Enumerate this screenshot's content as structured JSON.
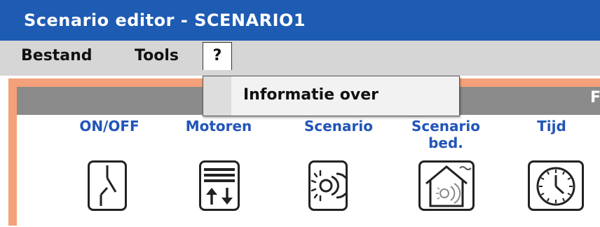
{
  "window": {
    "title": "Scenario editor - SCENARIO1"
  },
  "menubar": {
    "items": [
      {
        "label": "Bestand"
      },
      {
        "label": "Tools"
      },
      {
        "label": "?"
      }
    ]
  },
  "dropdown": {
    "items": [
      {
        "label": "Informatie over"
      }
    ]
  },
  "panel": {
    "header_partial": "Fa"
  },
  "toolbar": {
    "items": [
      {
        "label": "ON/OFF",
        "icon": "switch-icon"
      },
      {
        "label": "Motoren",
        "icon": "motor-icon"
      },
      {
        "label": "Scenario",
        "icon": "scenario-icon"
      },
      {
        "label": "Scenario\nbed.",
        "icon": "house-scenario-icon"
      },
      {
        "label": "Tijd",
        "icon": "clock-icon"
      }
    ]
  },
  "colors": {
    "titlebar": "#1e5bb2",
    "menubar": "#d6d6d6",
    "frame_border": "#f4a07a",
    "panel_header": "#8b8b8b",
    "toolbar_label": "#2155b8"
  }
}
